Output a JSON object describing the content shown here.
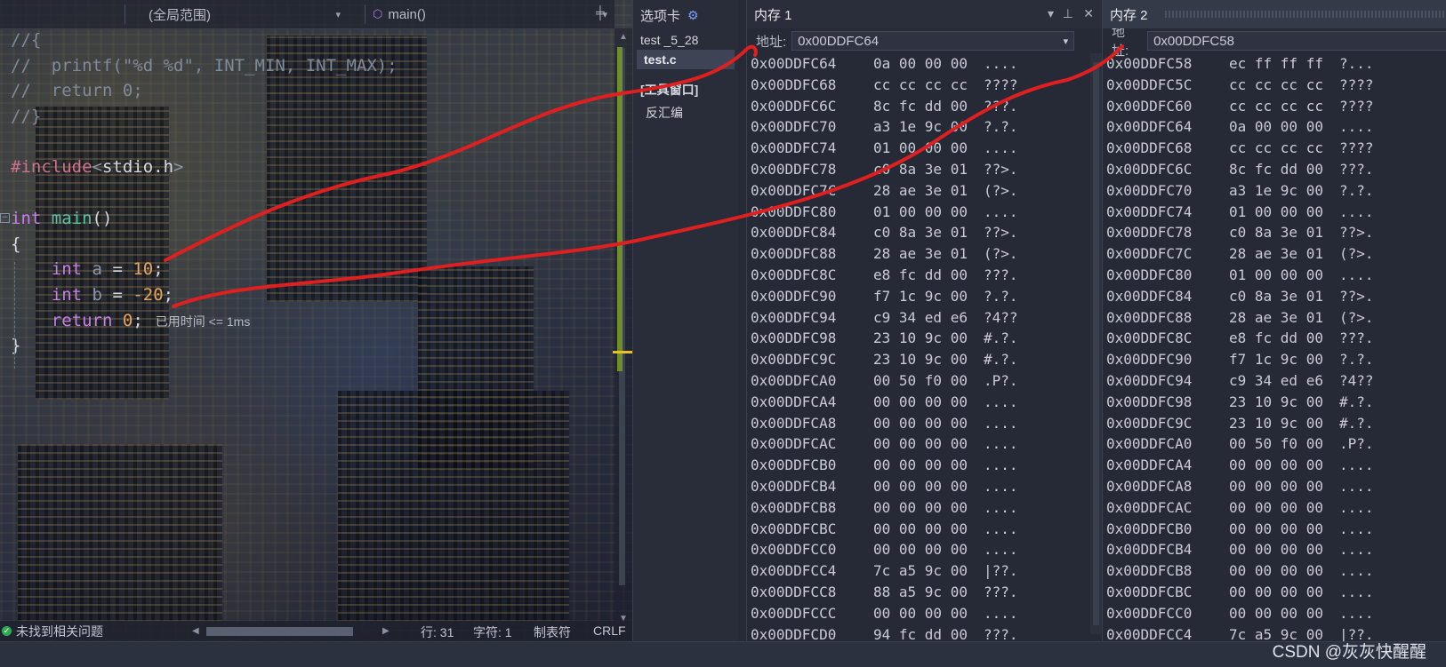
{
  "editor": {
    "nav_scope": "(全局范围)",
    "nav_function": "main()",
    "code_lines": [
      {
        "cls": "cmt",
        "text": "//{"
      },
      {
        "cls": "cmt",
        "text": "//  printf(\"%d %d\", INT_MIN, INT_MAX);"
      },
      {
        "cls": "cmt",
        "text": "//  return 0;"
      },
      {
        "cls": "cmt",
        "text": "//}"
      },
      {
        "cls": "",
        "text": ""
      },
      {
        "cls": "",
        "text": ""
      },
      {
        "cls": "",
        "text": ""
      },
      {
        "cls": "",
        "text": ""
      },
      {
        "cls": "",
        "text": ""
      },
      {
        "cls": "",
        "text": ""
      },
      {
        "cls": "",
        "text": ""
      },
      {
        "cls": "",
        "text": ""
      },
      {
        "cls": "",
        "text": ""
      }
    ],
    "include_directive": "#include",
    "include_open": "<",
    "include_file": "stdio.h",
    "include_close": ">",
    "kw_int": "int",
    "fn_main": "main",
    "parens": "()",
    "brace_open": "{",
    "brace_close": "}",
    "var_a": "a",
    "var_b": "b",
    "assign": " = ",
    "val_a": "10",
    "val_b": "-20",
    "semicolon": ";",
    "kw_return": "return",
    "val_ret": "0",
    "elapsed_tip": "已用时间 <= 1ms",
    "status": {
      "issues": "未找到相关问题",
      "line": "行: 31",
      "col": "字符: 1",
      "indent": "制表符",
      "eol": "CRLF"
    }
  },
  "solution": {
    "header": "选项卡",
    "items": [
      "test _5_28",
      "test.c"
    ],
    "group": "[工具窗口]",
    "sub_item": "反汇编"
  },
  "memory1": {
    "title": "内存 1",
    "addr_label": "地址:",
    "addr_value": "0x00DDFC64",
    "rows": [
      [
        "0x00DDFC64",
        "0a 00 00 00",
        "...."
      ],
      [
        "0x00DDFC68",
        "cc cc cc cc",
        "????"
      ],
      [
        "0x00DDFC6C",
        "8c fc dd 00",
        "???."
      ],
      [
        "0x00DDFC70",
        "a3 1e 9c 00",
        "?.?."
      ],
      [
        "0x00DDFC74",
        "01 00 00 00",
        "...."
      ],
      [
        "0x00DDFC78",
        "c0 8a 3e 01",
        "??>."
      ],
      [
        "0x00DDFC7C",
        "28 ae 3e 01",
        "(?>."
      ],
      [
        "0x00DDFC80",
        "01 00 00 00",
        "...."
      ],
      [
        "0x00DDFC84",
        "c0 8a 3e 01",
        "??>."
      ],
      [
        "0x00DDFC88",
        "28 ae 3e 01",
        "(?>."
      ],
      [
        "0x00DDFC8C",
        "e8 fc dd 00",
        "???."
      ],
      [
        "0x00DDFC90",
        "f7 1c 9c 00",
        "?.?."
      ],
      [
        "0x00DDFC94",
        "c9 34 ed e6",
        "?4??"
      ],
      [
        "0x00DDFC98",
        "23 10 9c 00",
        "#.?."
      ],
      [
        "0x00DDFC9C",
        "23 10 9c 00",
        "#.?."
      ],
      [
        "0x00DDFCA0",
        "00 50 f0 00",
        ".P?."
      ],
      [
        "0x00DDFCA4",
        "00 00 00 00",
        "...."
      ],
      [
        "0x00DDFCA8",
        "00 00 00 00",
        "...."
      ],
      [
        "0x00DDFCAC",
        "00 00 00 00",
        "...."
      ],
      [
        "0x00DDFCB0",
        "00 00 00 00",
        "...."
      ],
      [
        "0x00DDFCB4",
        "00 00 00 00",
        "...."
      ],
      [
        "0x00DDFCB8",
        "00 00 00 00",
        "...."
      ],
      [
        "0x00DDFCBC",
        "00 00 00 00",
        "...."
      ],
      [
        "0x00DDFCC0",
        "00 00 00 00",
        "...."
      ],
      [
        "0x00DDFCC4",
        "7c a5 9c 00",
        "|??."
      ],
      [
        "0x00DDFCC8",
        "88 a5 9c 00",
        "???."
      ],
      [
        "0x00DDFCCC",
        "00 00 00 00",
        "...."
      ],
      [
        "0x00DDFCD0",
        "94 fc dd 00",
        "???."
      ]
    ]
  },
  "memory2": {
    "title": "内存 2",
    "addr_label": "地址:",
    "addr_value": "0x00DDFC58",
    "rows": [
      [
        "0x00DDFC58",
        "ec ff ff ff",
        "?..."
      ],
      [
        "0x00DDFC5C",
        "cc cc cc cc",
        "????"
      ],
      [
        "0x00DDFC60",
        "cc cc cc cc",
        "????"
      ],
      [
        "0x00DDFC64",
        "0a 00 00 00",
        "...."
      ],
      [
        "0x00DDFC68",
        "cc cc cc cc",
        "????"
      ],
      [
        "0x00DDFC6C",
        "8c fc dd 00",
        "???."
      ],
      [
        "0x00DDFC70",
        "a3 1e 9c 00",
        "?.?."
      ],
      [
        "0x00DDFC74",
        "01 00 00 00",
        "...."
      ],
      [
        "0x00DDFC78",
        "c0 8a 3e 01",
        "??>."
      ],
      [
        "0x00DDFC7C",
        "28 ae 3e 01",
        "(?>."
      ],
      [
        "0x00DDFC80",
        "01 00 00 00",
        "...."
      ],
      [
        "0x00DDFC84",
        "c0 8a 3e 01",
        "??>."
      ],
      [
        "0x00DDFC88",
        "28 ae 3e 01",
        "(?>."
      ],
      [
        "0x00DDFC8C",
        "e8 fc dd 00",
        "???."
      ],
      [
        "0x00DDFC90",
        "f7 1c 9c 00",
        "?.?."
      ],
      [
        "0x00DDFC94",
        "c9 34 ed e6",
        "?4??"
      ],
      [
        "0x00DDFC98",
        "23 10 9c 00",
        "#.?."
      ],
      [
        "0x00DDFC9C",
        "23 10 9c 00",
        "#.?."
      ],
      [
        "0x00DDFCA0",
        "00 50 f0 00",
        ".P?."
      ],
      [
        "0x00DDFCA4",
        "00 00 00 00",
        "...."
      ],
      [
        "0x00DDFCA8",
        "00 00 00 00",
        "...."
      ],
      [
        "0x00DDFCAC",
        "00 00 00 00",
        "...."
      ],
      [
        "0x00DDFCB0",
        "00 00 00 00",
        "...."
      ],
      [
        "0x00DDFCB4",
        "00 00 00 00",
        "...."
      ],
      [
        "0x00DDFCB8",
        "00 00 00 00",
        "...."
      ],
      [
        "0x00DDFCBC",
        "00 00 00 00",
        "...."
      ],
      [
        "0x00DDFCC0",
        "00 00 00 00",
        "...."
      ],
      [
        "0x00DDFCC4",
        "7c a5 9c 00",
        "|??."
      ]
    ]
  },
  "watermark": "CSDN @灰灰快醒醒",
  "colors": {
    "annotation": "#e02020",
    "accent_green": "#6f8f2e",
    "cursor_yellow": "#e8c020"
  }
}
